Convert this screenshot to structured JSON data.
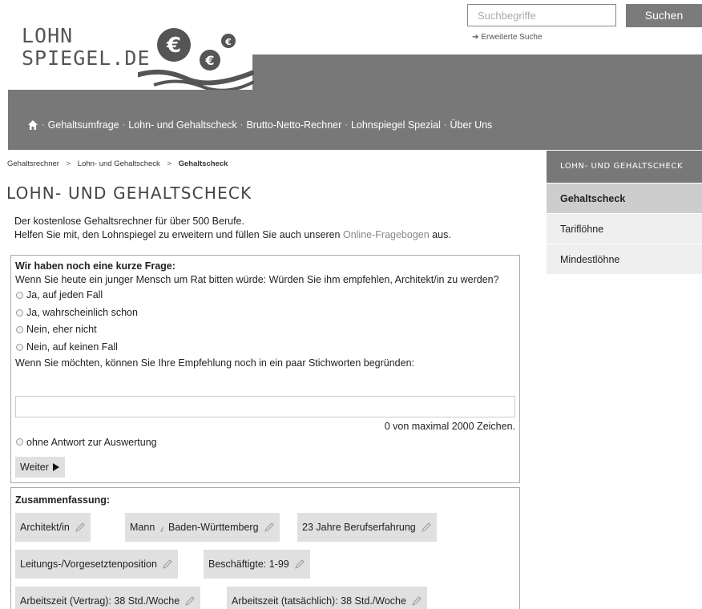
{
  "search": {
    "placeholder": "Suchbegriffe",
    "button": "Suchen",
    "advanced": "Erweiterte Suche"
  },
  "logo": {
    "line1": "LOHN",
    "line2": "SPIEGEL.DE"
  },
  "nav": {
    "items": [
      "Gehaltsumfrage",
      "Lohn- und Gehaltscheck",
      "Brutto-Netto-Rechner",
      "Lohnspiegel Spezial",
      "Über Uns"
    ],
    "separator": "·"
  },
  "breadcrumb": {
    "items": [
      "Gehaltsrechner",
      "Lohn- und Gehaltscheck",
      "Gehaltscheck"
    ],
    "separator": ">"
  },
  "page_title": "LOHN- UND GEHALTSCHECK",
  "intro": {
    "line1": "Der kostenlose Gehaltsrechner für über 500 Berufe.",
    "line2_pre": "Helfen Sie mit, den Lohnspiegel zu erweitern und füllen Sie auch unseren ",
    "line2_link": "Online-Fragebogen",
    "line2_post": " aus."
  },
  "sidebar": {
    "heading": "LOHN- UND GEHALTSCHECK",
    "items": [
      "Gehaltscheck",
      "Tariflöhne",
      "Mindestlöhne"
    ]
  },
  "question": {
    "title": "Wir haben noch eine kurze Frage:",
    "text": "Wenn Sie heute ein junger Mensch um Rat bitten würde: Würden Sie ihm empfehlen, Architekt/in zu werden?",
    "options": [
      "Ja, auf jeden Fall",
      "Ja, wahrscheinlich schon",
      "Nein, eher nicht",
      "Nein, auf keinen Fall"
    ],
    "reason_prompt": "Wenn Sie möchten, können Sie Ihre Empfehlung noch in ein paar Stichworten begründen:",
    "char_count": "0 von maximal 2000 Zeichen.",
    "no_answer": "ohne Antwort zur Auswertung",
    "next_button": "Weiter"
  },
  "summary": {
    "title": "Zusammenfassung:",
    "chips": [
      "Architekt/in",
      "Mann",
      "Baden-Württemberg",
      "23 Jahre Berufserfahrung",
      "Leitungs-/Vorgesetztenposition",
      "Beschäftigte: 1-99",
      "Arbeitszeit (Vertrag): 38 Std./Woche",
      "Arbeitszeit (tatsächlich): 38 Std./Woche"
    ]
  }
}
